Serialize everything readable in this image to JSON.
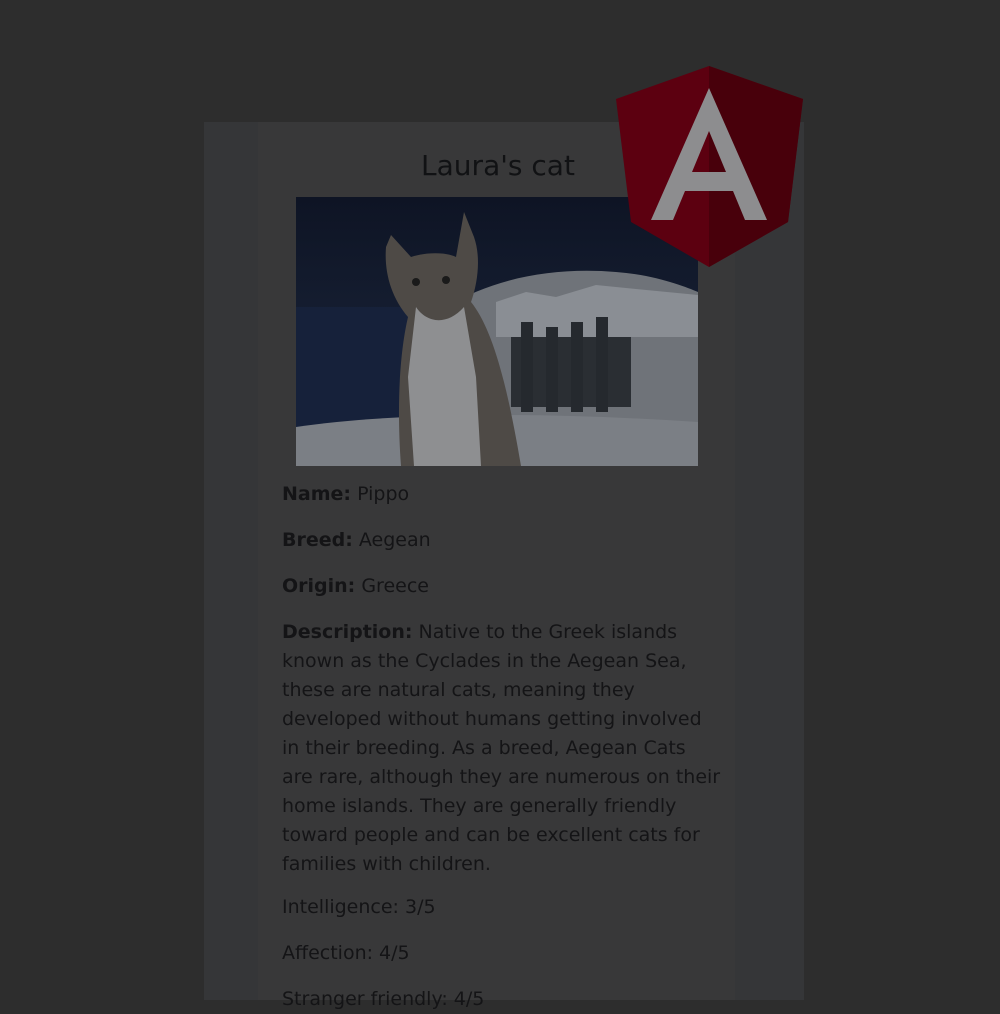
{
  "card": {
    "title": "Laura's cat",
    "photo_alt": "cat on a whitewashed terrace above the sea"
  },
  "fields": {
    "name_label": "Name:",
    "name_value": "Pippo",
    "breed_label": "Breed:",
    "breed_value": "Aegean",
    "origin_label": "Origin:",
    "origin_value": "Greece",
    "description_label": "Description:",
    "description_value": "Native to the Greek islands known as the Cyclades in the Aegean Sea, these are natural cats, meaning they developed without humans getting involved in their breeding. As a breed, Aegean Cats are rare, although they are numerous on their home islands. They are generally friendly toward people and can be excellent cats for families with children.",
    "intelligence": "Intelligence: 3/5",
    "affection": "Affection: 4/5",
    "stranger_friendly": "Stranger friendly: 4/5"
  },
  "logo": {
    "icon": "angular-logo-icon",
    "letter": "A",
    "color": "#5c0010"
  },
  "colors": {
    "page_background": "#2d2d2d",
    "card_background": "#383839",
    "text": "#141416"
  }
}
